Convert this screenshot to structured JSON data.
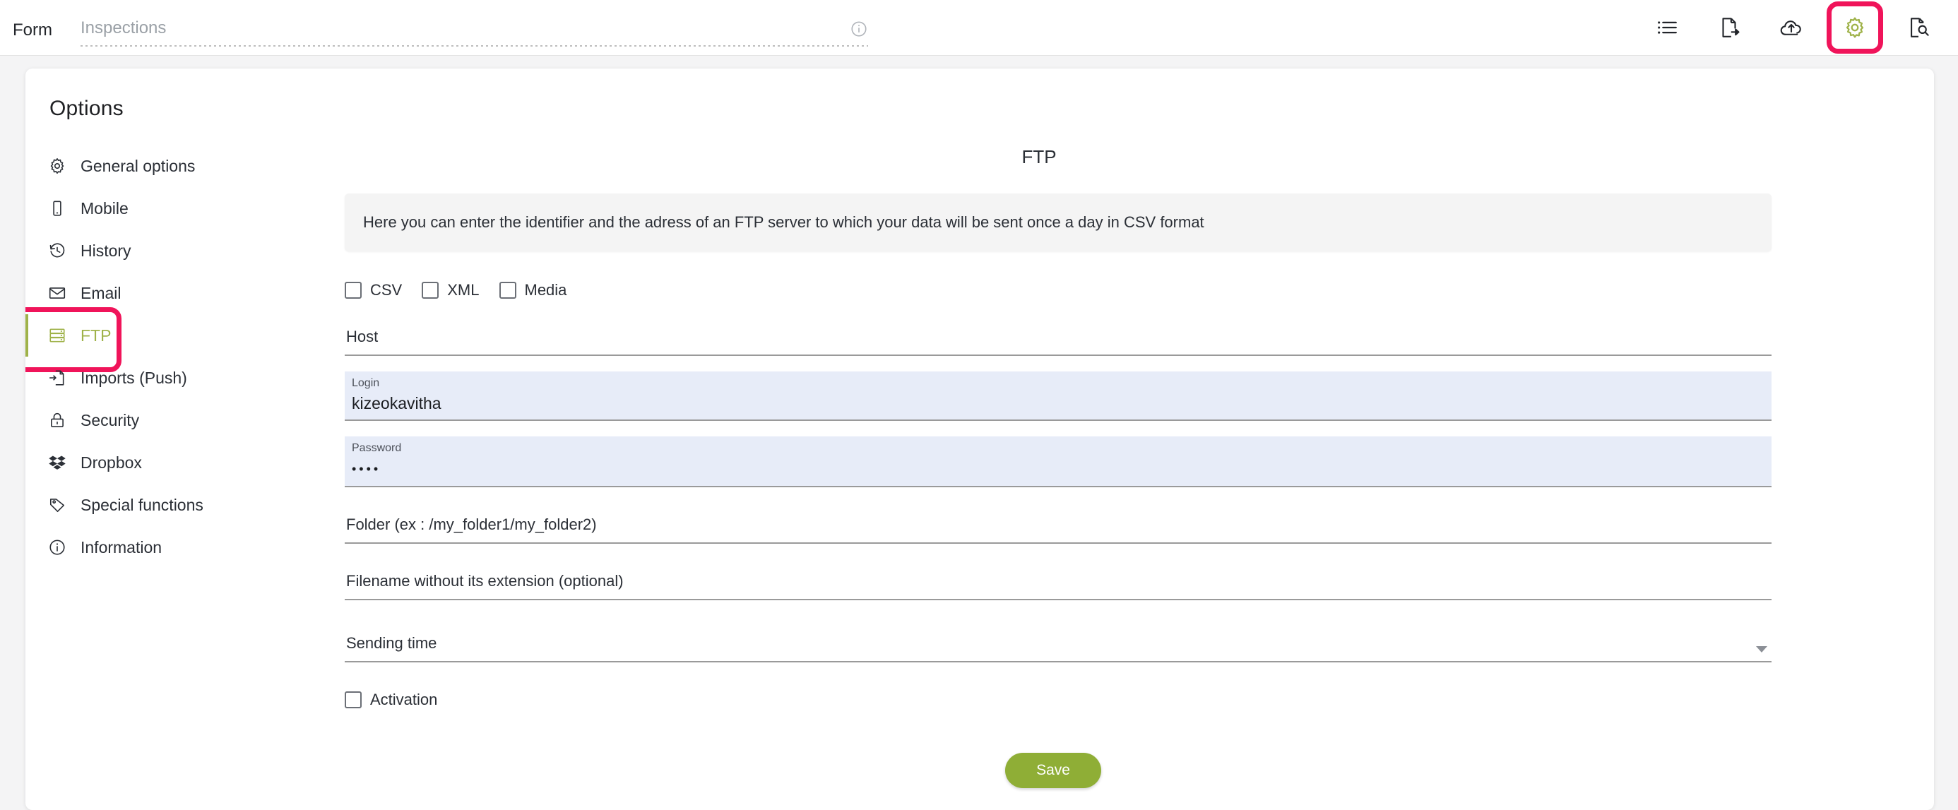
{
  "topbar": {
    "form_label": "Form",
    "form_name_value": "",
    "form_name_placeholder": "Inspections",
    "info_icon": "info-circle-icon",
    "actions": [
      {
        "name": "list-icon",
        "label": "List"
      },
      {
        "name": "file-export-icon",
        "label": "Export"
      },
      {
        "name": "cloud-upload-icon",
        "label": "Upload"
      },
      {
        "name": "gear-icon",
        "label": "Options",
        "highlighted": true,
        "color": "#9fb249"
      },
      {
        "name": "document-search-icon",
        "label": "Preview"
      }
    ]
  },
  "dialog": {
    "title": "Options"
  },
  "sidebar": {
    "items": [
      {
        "label": "General options",
        "icon": "gear-icon",
        "active": false
      },
      {
        "label": "Mobile",
        "icon": "mobile-icon",
        "active": false
      },
      {
        "label": "History",
        "icon": "history-icon",
        "active": false
      },
      {
        "label": "Email",
        "icon": "envelope-icon",
        "active": false
      },
      {
        "label": "FTP",
        "icon": "server-icon",
        "active": true,
        "highlighted": true
      },
      {
        "label": "Imports (Push)",
        "icon": "import-icon",
        "active": false
      },
      {
        "label": "Security",
        "icon": "lock-icon",
        "active": false
      },
      {
        "label": "Dropbox",
        "icon": "dropbox-icon",
        "active": false
      },
      {
        "label": "Special functions",
        "icon": "tag-icon",
        "active": false
      },
      {
        "label": "Information",
        "icon": "info-circle-icon",
        "active": false
      }
    ]
  },
  "content": {
    "heading": "FTP",
    "notice": "Here you can enter the identifier and the adress of an FTP server to which your data will be sent once a day in CSV format",
    "format_checkboxes": [
      {
        "label": "CSV",
        "checked": false
      },
      {
        "label": "XML",
        "checked": false
      },
      {
        "label": "Media",
        "checked": false
      }
    ],
    "fields": {
      "host": {
        "label": "Host",
        "value": ""
      },
      "login": {
        "label": "Login",
        "value": "kizeokavitha"
      },
      "password": {
        "label": "Password",
        "value": "••••"
      },
      "folder": {
        "label": "Folder (ex : /my_folder1/my_folder2)",
        "value": ""
      },
      "filename": {
        "label": "Filename without its extension (optional)",
        "value": ""
      },
      "sending_time": {
        "label": "Sending time",
        "value": ""
      }
    },
    "activation": {
      "label": "Activation",
      "checked": false
    },
    "save_label": "Save"
  },
  "colors": {
    "accent_green": "#9fb249",
    "save_green": "#8fae36",
    "highlight_pink": "#f0145a",
    "filled_field_bg": "#e7ecf8",
    "notice_bg": "#f4f4f4"
  }
}
